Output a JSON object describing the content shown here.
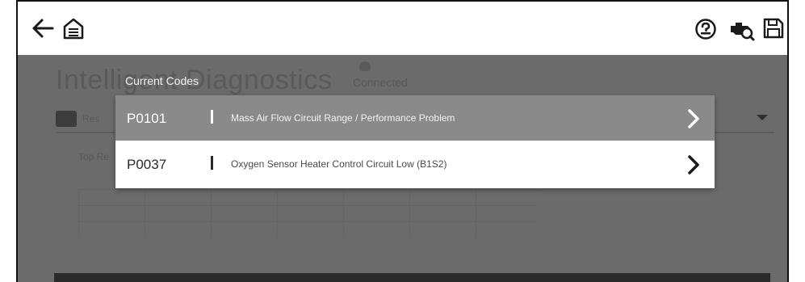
{
  "toolbar": {
    "back_icon": "back-arrow-icon",
    "home_icon": "home-icon",
    "help_icon": "help-icon",
    "vehicle_icon": "vehicle-scan-icon",
    "save_icon": "save-icon"
  },
  "background": {
    "title": "Intelligent Diagnostics",
    "status": "Connected",
    "tab_partial": "Res",
    "top_partial": "Top Re"
  },
  "dialog": {
    "title": "Current Codes",
    "codes": [
      {
        "code": "P0101",
        "description": "Mass Air Flow Circuit Range / Performance Problem",
        "selected": true
      },
      {
        "code": "P0037",
        "description": "Oxygen Sensor Heater Control Circuit Low (B1S2)",
        "selected": false
      }
    ]
  },
  "colors": {
    "overlay": "#6b6b6b",
    "selected_row": "#8a8a8a",
    "dialog_bg": "#ffffff"
  }
}
